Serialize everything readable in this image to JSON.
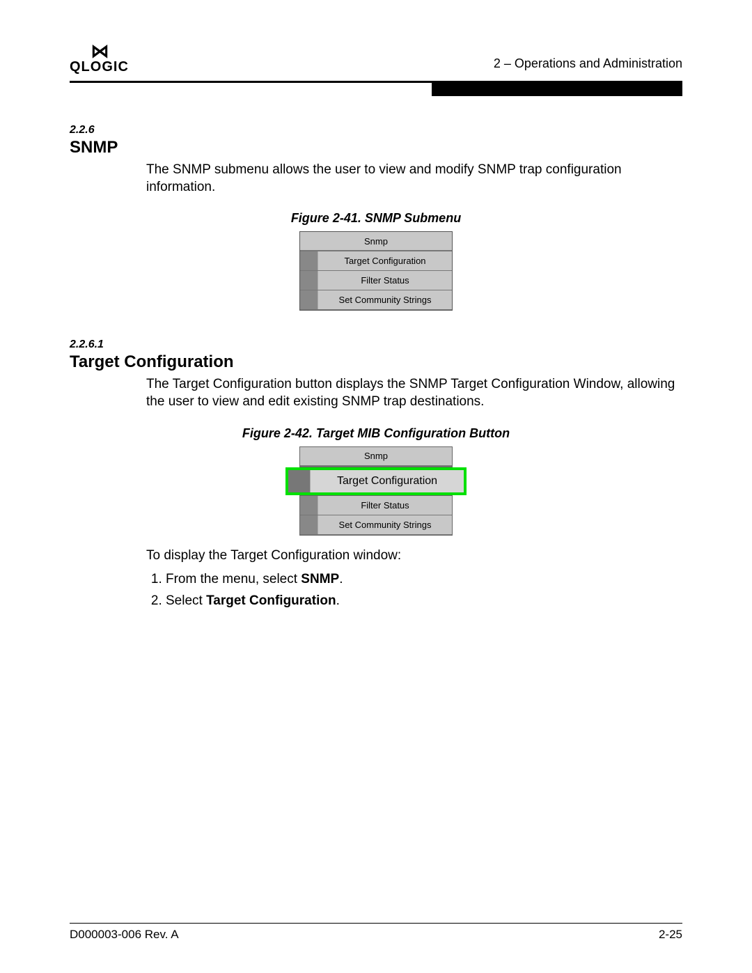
{
  "header": {
    "logo_glyph": "⋈",
    "logo_text": "QLOGIC",
    "chapter_ref": "2 – Operations and Administration"
  },
  "section": {
    "num": "2.2.6",
    "title": "Snmp",
    "body": "The SNMP submenu allows the user to view and modify SNMP trap configuration information."
  },
  "fig1": {
    "caption": "Figure 2-41. SNMP Submenu",
    "menu_header": "Snmp",
    "rows": [
      "Target Configuration",
      "Filter Status",
      "Set Community Strings"
    ]
  },
  "subsection": {
    "num": "2.2.6.1",
    "title": "Target Configuration",
    "body": "The Target Configuration button displays the SNMP Target Configuration Window, allowing the user to view and edit existing SNMP trap destinations."
  },
  "fig2": {
    "caption": "Figure 2-42. Target MIB Configuration Button",
    "menu_header": "Snmp",
    "selected": "Target Configuration",
    "rows": [
      "Filter Status",
      "Set Community Strings"
    ]
  },
  "instructions": {
    "lead": "To display the Target Configuration window:",
    "step1_a": "From the menu, select ",
    "step1_b": "SNMP",
    "step1_c": ".",
    "step2_a": "Select ",
    "step2_b": "Target Configuration",
    "step2_c": "."
  },
  "footer": {
    "left": "D000003-006 Rev. A",
    "right": "2-25"
  }
}
